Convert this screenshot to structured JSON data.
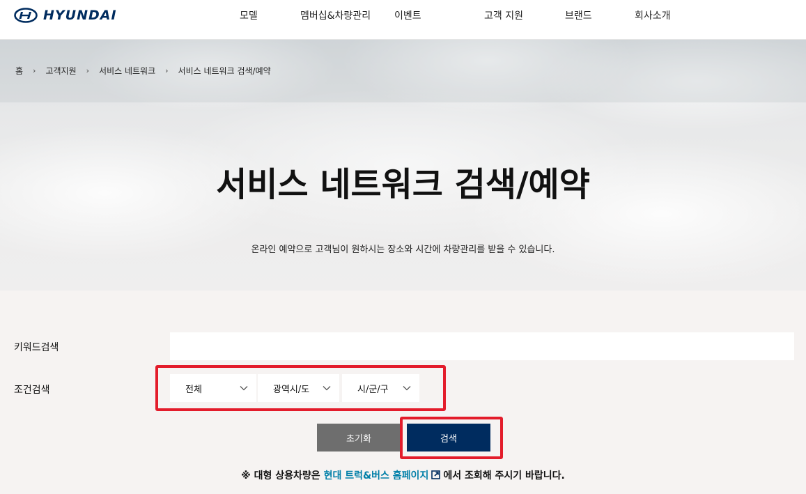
{
  "header": {
    "logo_text": "HYUNDAI",
    "nav": [
      "모델",
      "멤버십&차량관리",
      "이벤트",
      "고객 지원",
      "브랜드",
      "회사소개"
    ]
  },
  "breadcrumb": [
    "홈",
    "고객지원",
    "서비스 네트워크",
    "서비스 네트워크 검색/예약"
  ],
  "hero": {
    "title": "서비스 네트워크 검색/예약",
    "description": "온라인 예약으로 고객님이 원하시는 장소와 시간에 차량관리를 받을 수 있습니다."
  },
  "form": {
    "keyword_label": "키워드검색",
    "keyword_value": "",
    "condition_label": "조건검색",
    "selects": [
      "전체",
      "광역시/도",
      "시/군/구"
    ],
    "reset_label": "초기화",
    "search_label": "검색"
  },
  "notice": {
    "prefix": "※ 대형 상용차량은",
    "link_text": "현대 트럭&버스 홈페이지",
    "suffix": "에서 조회해 주시기 바랍니다."
  },
  "colors": {
    "brand": "#002c5f",
    "highlight": "#e31c2b",
    "link": "#007fa8",
    "reset_button": "#6e6e6e"
  },
  "icons": [
    "hyundai-logo-icon",
    "chevron-right-icon",
    "chevron-down-icon",
    "external-link-icon"
  ]
}
